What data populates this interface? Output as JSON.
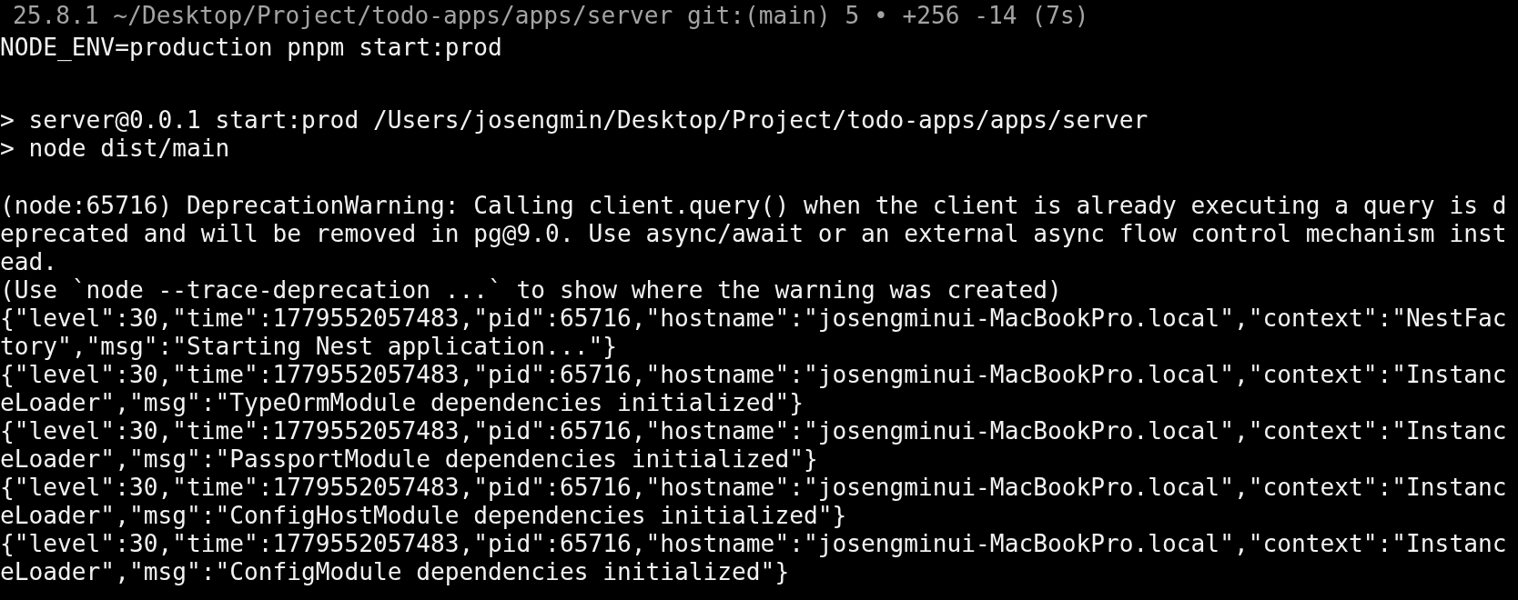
{
  "terminal": {
    "blocks": [
      {
        "lines": [
          {
            "kind": "prompt",
            "text": "25.8.1 ~/Desktop/Project/todo-apps/apps/server git:(main) 5 • +256 -14 (7s)"
          },
          {
            "kind": "command",
            "text": "NODE_ENV=production pnpm start:prod"
          }
        ]
      },
      {
        "lines": [
          {
            "kind": "output",
            "text": "> server@0.0.1 start:prod /Users/josengmin/Desktop/Project/todo-apps/apps/server"
          },
          {
            "kind": "output",
            "text": "> node dist/main"
          }
        ]
      },
      {
        "lines": [
          {
            "kind": "output",
            "text": "(node:65716) DeprecationWarning: Calling client.query() when the client is already executing a query is d"
          },
          {
            "kind": "output",
            "text": "eprecated and will be removed in pg@9.0. Use async/await or an external async flow control mechanism inst"
          },
          {
            "kind": "output",
            "text": "ead."
          },
          {
            "kind": "output",
            "text": "(Use `node --trace-deprecation ...` to show where the warning was created)"
          },
          {
            "kind": "output",
            "text": "{\"level\":30,\"time\":1779552057483,\"pid\":65716,\"hostname\":\"josengminui-MacBookPro.local\",\"context\":\"NestFac"
          },
          {
            "kind": "output",
            "text": "tory\",\"msg\":\"Starting Nest application...\"}"
          },
          {
            "kind": "output",
            "text": "{\"level\":30,\"time\":1779552057483,\"pid\":65716,\"hostname\":\"josengminui-MacBookPro.local\",\"context\":\"Instanc"
          },
          {
            "kind": "output",
            "text": "eLoader\",\"msg\":\"TypeOrmModule dependencies initialized\"}"
          },
          {
            "kind": "output",
            "text": "{\"level\":30,\"time\":1779552057483,\"pid\":65716,\"hostname\":\"josengminui-MacBookPro.local\",\"context\":\"Instanc"
          },
          {
            "kind": "output",
            "text": "eLoader\",\"msg\":\"PassportModule dependencies initialized\"}"
          },
          {
            "kind": "output",
            "text": "{\"level\":30,\"time\":1779552057483,\"pid\":65716,\"hostname\":\"josengminui-MacBookPro.local\",\"context\":\"Instanc"
          },
          {
            "kind": "output",
            "text": "eLoader\",\"msg\":\"ConfigHostModule dependencies initialized\"}"
          },
          {
            "kind": "output",
            "text": "{\"level\":30,\"time\":1779552057483,\"pid\":65716,\"hostname\":\"josengminui-MacBookPro.local\",\"context\":\"Instanc"
          },
          {
            "kind": "output",
            "text": "eLoader\",\"msg\":\"ConfigModule dependencies initialized\"}"
          }
        ]
      }
    ]
  }
}
